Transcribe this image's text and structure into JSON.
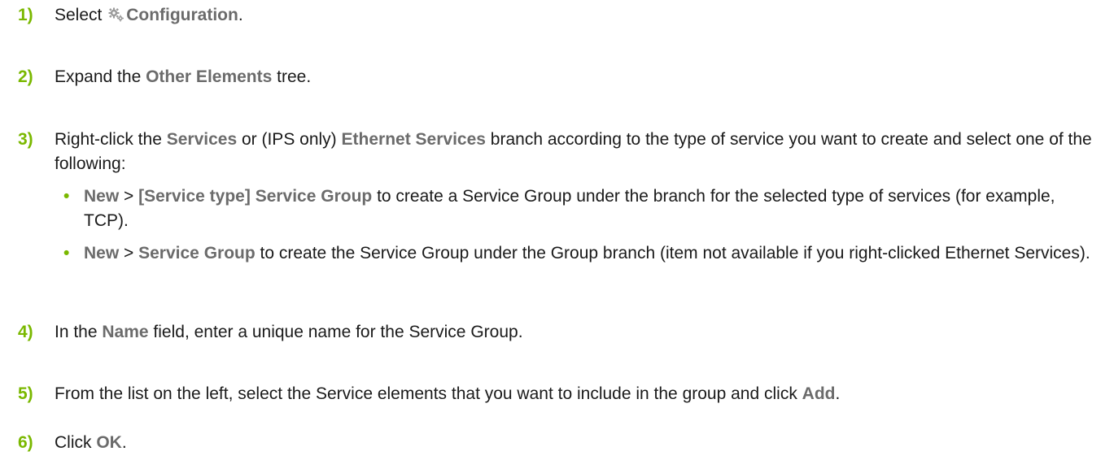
{
  "steps": [
    {
      "num": "1)",
      "pre": "Select ",
      "ui": "Configuration",
      "post": ".",
      "icon": "gear-icon"
    },
    {
      "num": "2)",
      "pre": "Expand the ",
      "ui": "Other Elements",
      "post": " tree."
    },
    {
      "num": "3)",
      "t1": "Right-click the ",
      "u1": "Services",
      "t2": " or (IPS only) ",
      "u2": "Ethernet Services",
      "t3": " branch according to the type of service you want to create and select one of the following:",
      "bullets": [
        {
          "dot": "•",
          "u1": "New",
          "sep": " > ",
          "u2": "[Service type] Service Group",
          "text": " to create a Service Group under the branch for the selected type of services (for example, TCP)."
        },
        {
          "dot": "•",
          "u1": "New",
          "sep": " > ",
          "u2": "Service Group",
          "text": " to create the Service Group under the Group branch (item not available if you right-clicked Ethernet Services)."
        }
      ]
    },
    {
      "num": "4)",
      "pre": "In the ",
      "ui": "Name",
      "post": " field, enter a unique name for the Service Group."
    },
    {
      "num": "5)",
      "pre": "From the list on the left, select the Service elements that you want to include in the group and click ",
      "ui": "Add",
      "post": "."
    },
    {
      "num": "6)",
      "pre": "Click ",
      "ui": "OK",
      "post": "."
    }
  ],
  "colors": {
    "number": "#7ab800",
    "ui_term": "#6b6b6b",
    "text": "#1a1a1a"
  }
}
